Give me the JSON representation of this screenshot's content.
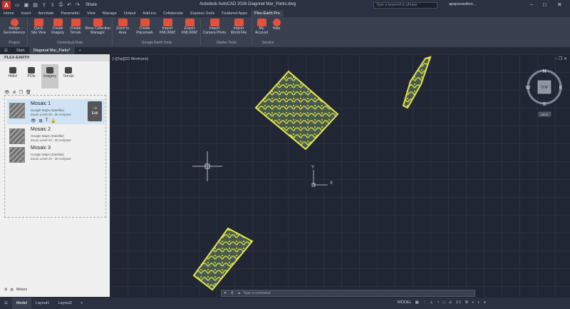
{
  "titlebar": {
    "app_logo": "A",
    "share": "Share",
    "title": "Autodesk AutoCAD 2026   Diagonal Mar_Parks.dwg",
    "search_placeholder": "Type a keyword or phrase",
    "user": "apapavasileio..."
  },
  "menu_tabs": [
    "Home",
    "Insert",
    "Annotate",
    "Parametric",
    "View",
    "Manage",
    "Output",
    "Add-ins",
    "Collaborate",
    "Express Tools",
    "Featured Apps",
    "Plex-Earth Pro"
  ],
  "active_menu_tab": "Plex-Earth Pro",
  "ribbon": {
    "buttons": [
      {
        "label1": "Assign",
        "label2": "Georeference"
      },
      {
        "label1": "Quick",
        "label2": "Site View"
      },
      {
        "label1": "Create",
        "label2": "Imagery"
      },
      {
        "label1": "Create",
        "label2": "Terrain"
      },
      {
        "label1": "Show Collection",
        "label2": "Manager"
      },
      {
        "label1": "Zoom to",
        "label2": "Area"
      },
      {
        "label1": "Create",
        "label2": "Placemark"
      },
      {
        "label1": "Import",
        "label2": "KML/KMZ"
      },
      {
        "label1": "Export",
        "label2": "KML/KMZ"
      },
      {
        "label1": "Import",
        "label2": "Camera Photo"
      },
      {
        "label1": "Import",
        "label2": "World File"
      },
      {
        "label1": "My",
        "label2": "Account"
      },
      {
        "label1": "Help",
        "label2": ""
      }
    ],
    "groups": [
      "Project",
      "Contextual Data",
      "Google Earth Tools",
      "Raster Tools",
      "Service"
    ]
  },
  "doc_tabs": [
    "Start",
    "Diagonal Mar_Parks*"
  ],
  "palette": {
    "header": "PLEX-EARTH",
    "tabs": [
      "Hello!",
      "POIs",
      "Imagery",
      "Terrain"
    ],
    "active_tab": "Imagery",
    "mosaics": [
      {
        "name": "Mosaic 1",
        "source": "Google Maps (Satellite)",
        "zoom": "Zoom Level 19 - 30 cm/pixel"
      },
      {
        "name": "Mosaic 2",
        "source": "Google Maps (Satellite)",
        "zoom": "Zoom Level 19 - 30 cm/pixel"
      },
      {
        "name": "Mosaic 3",
        "source": "Google Maps (Satellite)",
        "zoom": "Zoom Level 19 - 30 cm/pixel"
      }
    ],
    "edit_label": "Edit",
    "footer": "Meters"
  },
  "viewport": {
    "label": "[–][Top][2D Wireframe]",
    "compass": {
      "n": "N",
      "s": "S",
      "e": "E",
      "w": "W",
      "center": "TOP",
      "wcs": "WCS"
    },
    "ucs": {
      "x": "X",
      "y": "Y"
    }
  },
  "command_placeholder": "Type a command",
  "statusbar": {
    "tabs": [
      "Model",
      "Layout1",
      "Layout2"
    ],
    "model_label": "MODEL",
    "scale": "1:1"
  },
  "colors": {
    "accent": "#e2513c",
    "viewport_bg": "#212634",
    "imagery_outline": "#e6e64a"
  }
}
